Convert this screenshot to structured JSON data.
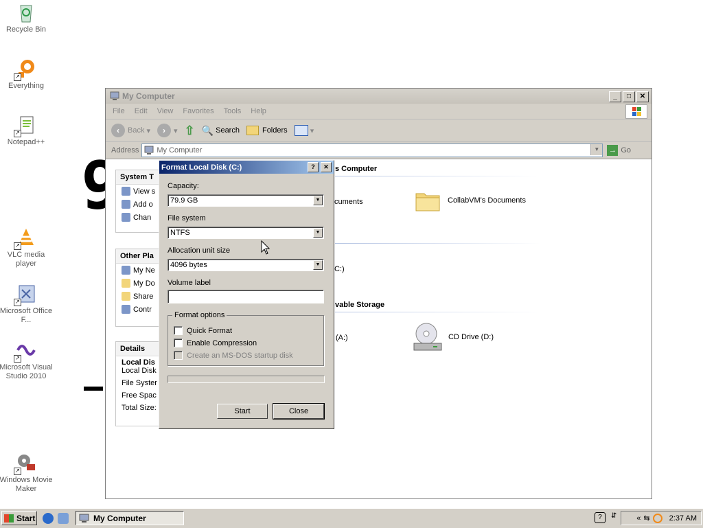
{
  "desktop": {
    "icons": [
      {
        "label": "Recycle Bin",
        "icon": "recycle-bin-icon"
      },
      {
        "label": "Everything",
        "icon": "everything-icon"
      },
      {
        "label": "Notepad++",
        "icon": "notepad-plus-plus-icon"
      },
      {
        "label": "VLC media player",
        "icon": "vlc-icon"
      },
      {
        "label": "Microsoft Office F...",
        "icon": "office-icon"
      },
      {
        "label": "Microsoft Visual Studio 2010",
        "icon": "visual-studio-icon"
      },
      {
        "label": "Windows Movie Maker",
        "icon": "movie-maker-icon"
      }
    ]
  },
  "explorer": {
    "title": "My Computer",
    "menu": [
      "File",
      "Edit",
      "View",
      "Favorites",
      "Tools",
      "Help"
    ],
    "toolbar": {
      "back": "Back",
      "search": "Search",
      "folders": "Folders"
    },
    "address_label": "Address",
    "address_value": "My Computer",
    "go_label": "Go",
    "panels": {
      "system_tasks": {
        "header": "System T",
        "items": [
          "View s",
          "Add o",
          "Chan"
        ]
      },
      "other_places": {
        "header": "Other Pla",
        "items": [
          "My Ne",
          "My Do",
          "Share",
          "Contr"
        ]
      },
      "details": {
        "header": "Details",
        "name": "Local Dis",
        "type": "Local Disk",
        "fs": "File Syster",
        "free": "Free Spac",
        "total": "Total Size:"
      }
    },
    "sections": {
      "files_header": "s Computer",
      "shared_docs": "cuments",
      "collab_docs": "CollabVM's Documents",
      "local_disk": "C:)",
      "removable_header": "vable Storage",
      "floppy": "(A:)",
      "cd_drive": "CD Drive (D:)"
    }
  },
  "format_dialog": {
    "title": "Format Local Disk (C:)",
    "capacity_label": "Capacity:",
    "capacity_value": "79.9 GB",
    "filesystem_label": "File system",
    "filesystem_value": "NTFS",
    "alloc_label": "Allocation unit size",
    "alloc_value": "4096 bytes",
    "volume_label": "Volume label",
    "volume_value": "",
    "options_title": "Format options",
    "quick_format": "Quick Format",
    "enable_compression": "Enable Compression",
    "msdos_disk": "Create an MS-DOS startup disk",
    "start": "Start",
    "close": "Close"
  },
  "taskbar": {
    "start": "Start",
    "task": "My Computer",
    "clock": "2:37 AM",
    "chevron": "«"
  },
  "colors": {
    "dialog_title_start": "#0a246a",
    "dialog_title_end": "#a6caf0",
    "window_face": "#d4d0c8"
  }
}
